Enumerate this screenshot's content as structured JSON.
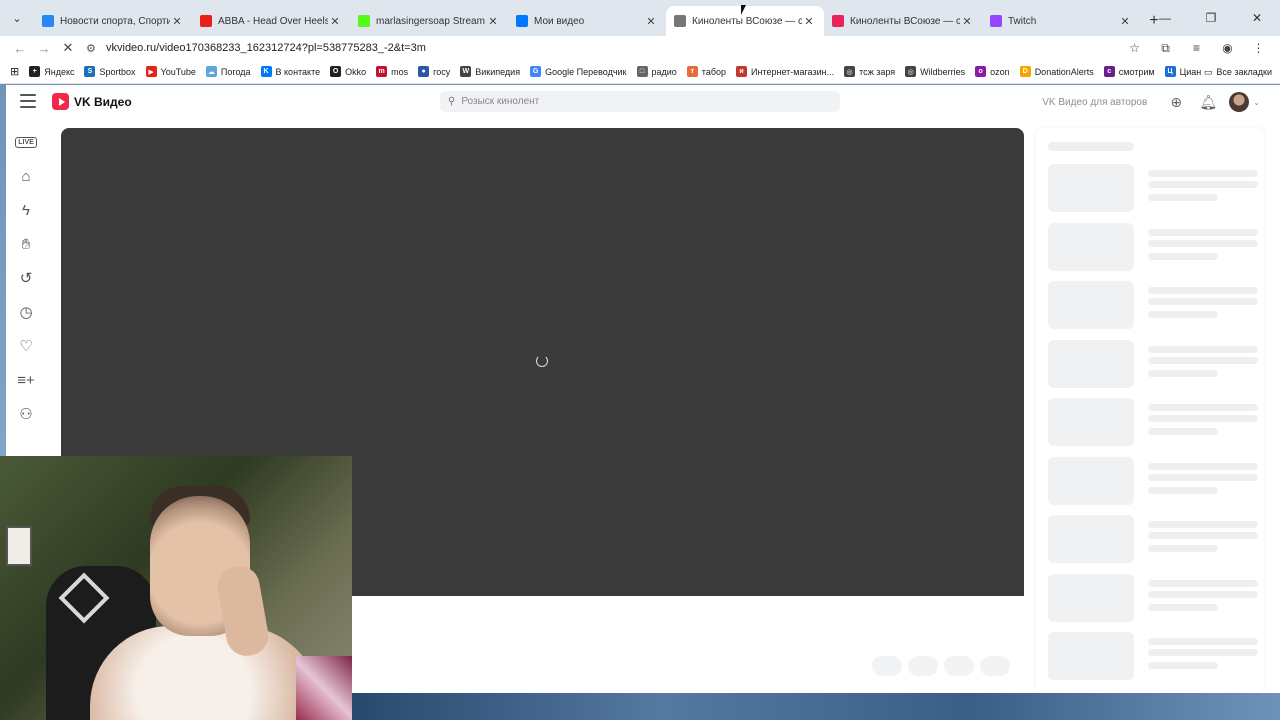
{
  "browser": {
    "tabs": [
      {
        "title": "Новости спорта, Спортивная а",
        "icon": "vk-news-icon",
        "color": "#2787f5",
        "active": false
      },
      {
        "title": "ABBA - Head Over Heels (Video",
        "icon": "youtube-icon",
        "color": "#e62117",
        "active": false
      },
      {
        "title": "marlasingersoap Stream - Wat",
        "icon": "kick-icon",
        "color": "#53fc18",
        "active": false
      },
      {
        "title": "Мои видео",
        "icon": "vk-icon",
        "color": "#0077ff",
        "active": false
      },
      {
        "title": "Киноленты ВСоюзе — смотре",
        "icon": "loading-icon",
        "color": "#777777",
        "active": true
      },
      {
        "title": "Киноленты ВСоюзе — смотре",
        "icon": "vk-video-icon",
        "color": "#e8235a",
        "active": false
      },
      {
        "title": "Twitch",
        "icon": "twitch-icon",
        "color": "#9146ff",
        "active": false
      }
    ],
    "url": "vkvideo.ru/video170368233_162312724?pl=538775283_-2&t=3m",
    "bookmarks": [
      {
        "label": "Яндекс",
        "color": "#222222",
        "glyph": "+"
      },
      {
        "label": "Sportbox",
        "color": "#1b6fb8",
        "glyph": "S"
      },
      {
        "label": "YouTube",
        "color": "#e62117",
        "glyph": "▶"
      },
      {
        "label": "Погода",
        "color": "#5aa7e0",
        "glyph": "☁"
      },
      {
        "label": "В контакте",
        "color": "#0077ff",
        "glyph": "K"
      },
      {
        "label": "Okko",
        "color": "#222222",
        "glyph": "O"
      },
      {
        "label": "mos",
        "color": "#c4122e",
        "glyph": "m"
      },
      {
        "label": "госу",
        "color": "#2b57a8",
        "glyph": "●"
      },
      {
        "label": "Википедия",
        "color": "#444444",
        "glyph": "W"
      },
      {
        "label": "Google Переводчик",
        "color": "#4285f4",
        "glyph": "G"
      },
      {
        "label": "радио",
        "color": "#666666",
        "glyph": "□"
      },
      {
        "label": "табор",
        "color": "#e86b3a",
        "glyph": "т"
      },
      {
        "label": "Интернет-магазин...",
        "color": "#c23a2b",
        "glyph": "и"
      },
      {
        "label": "тсж заря",
        "color": "#444444",
        "glyph": "◎"
      },
      {
        "label": "Wildberries",
        "color": "#444444",
        "glyph": "◎"
      },
      {
        "label": "ozon",
        "color": "#8a1ba8",
        "glyph": "o"
      },
      {
        "label": "DonationAlerts",
        "color": "#f6a300",
        "glyph": "D"
      },
      {
        "label": "смотрим",
        "color": "#6b1e8c",
        "glyph": "с"
      },
      {
        "label": "Циан",
        "color": "#1a6fd6",
        "glyph": "Ц"
      }
    ],
    "all_bookmarks": "Все закладки"
  },
  "vk": {
    "logo_text": "VK Видео",
    "search_placeholder": "Розыск кинолент",
    "authors_link": "VK Видео для авторов",
    "sidebar_icons": [
      "live-icon",
      "home-icon",
      "lightning-icon",
      "hand-icon",
      "history-icon",
      "clock-icon",
      "heart-icon",
      "playlist-add-icon",
      "community-icon"
    ],
    "live_label": "LIVE"
  },
  "colors": {
    "player_bg": "#3a3a3a",
    "vk_brand": "#f2284b"
  }
}
